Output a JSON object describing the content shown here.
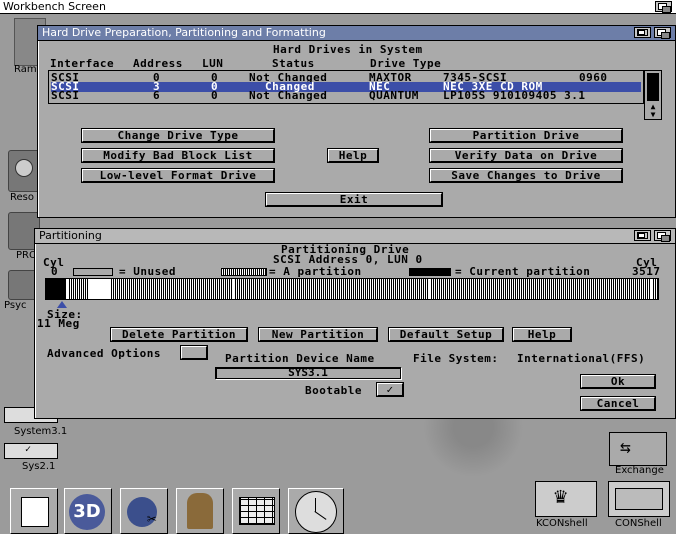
{
  "screen": {
    "title": "Workbench Screen"
  },
  "hd_window": {
    "title": "Hard Drive Preparation, Partitioning and Formatting",
    "list_title": "Hard Drives in System",
    "columns": [
      "Interface",
      "Address",
      "LUN",
      "Status",
      "Drive Type"
    ],
    "drives": [
      {
        "iface": "SCSI",
        "address": "0",
        "lun": "0",
        "status": "Not Changed",
        "vendor": "MAXTOR",
        "model": "7345-SCSI",
        "rev": "0960",
        "selected": false
      },
      {
        "iface": "SCSI",
        "address": "3",
        "lun": "0",
        "status": "Changed",
        "vendor": "NEC",
        "model": "NEC 3XE CD ROM",
        "rev": "",
        "selected": true
      },
      {
        "iface": "SCSI",
        "address": "6",
        "lun": "0",
        "status": "Not Changed",
        "vendor": "QUANTUM",
        "model": "LP105S 910109405 3.1",
        "rev": "",
        "selected": false
      }
    ],
    "buttons": {
      "change_type": "Change Drive Type",
      "modify_bad": "Modify Bad Block List",
      "lowlevel": "Low-level Format Drive",
      "help": "Help",
      "partition": "Partition Drive",
      "verify": "Verify Data on Drive",
      "save": "Save Changes to Drive",
      "exit": "Exit"
    }
  },
  "part_window": {
    "title": "Partitioning",
    "heading": "Partitioning Drive",
    "subheading": "SCSI Address 0, LUN 0",
    "cyl_label_left": "Cyl",
    "cyl_start": "0",
    "cyl_label_right": "Cyl",
    "cyl_end": "3517",
    "legend_unused": "= Unused",
    "legend_partition": "= A partition",
    "legend_current": "= Current partition",
    "size_label": "Size:",
    "size_value": "11 Meg",
    "buttons": {
      "delete": "Delete Partition",
      "new": "New Partition",
      "default": "Default Setup",
      "help": "Help",
      "ok": "Ok",
      "cancel": "Cancel"
    },
    "advanced_label": "Advanced Options",
    "device_name_label": "Partition Device Name",
    "device_name_value": "SYS3.1",
    "filesystem_label": "File System:",
    "filesystem_value": "International(FFS)",
    "bootable_label": "Bootable",
    "bootable_checked": true
  },
  "desktop_icons": {
    "ram": "Ram",
    "reso": "Reso",
    "pro": "PRO",
    "psyc": "Psyc",
    "system3": "System3.1",
    "sys2": "Sys2.1",
    "exchange": "Exchange",
    "kconshell": "KCONshell",
    "conshell": "CONShell"
  }
}
